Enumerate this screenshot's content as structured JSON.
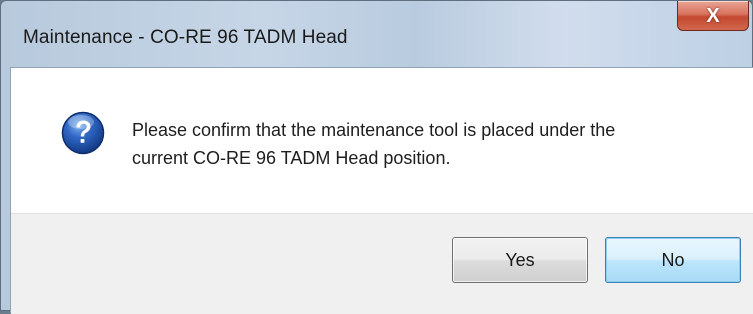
{
  "window": {
    "title": "Maintenance - CO-RE 96 TADM Head",
    "close_glyph": "X",
    "close_icon": "close-icon"
  },
  "dialog": {
    "icon": "question-icon",
    "message_line1": "Please confirm that the maintenance tool is placed under the",
    "message_line2": "current CO-RE 96 TADM Head position."
  },
  "buttons": {
    "yes_label": "Yes",
    "no_label": "No"
  },
  "colors": {
    "titlebar": "#c6d6e7",
    "close_button": "#c4482f",
    "icon_blue": "#1f4fa3",
    "button_strip": "#f0f0f0",
    "default_button_border": "#3c7fb1"
  }
}
